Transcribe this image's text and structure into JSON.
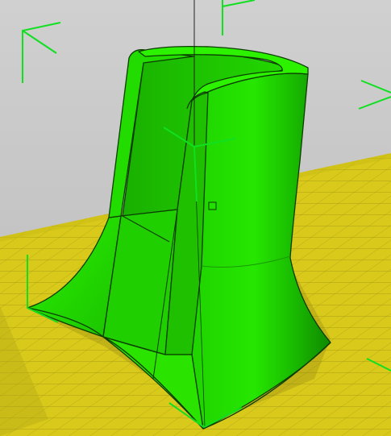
{
  "viewport": {
    "background_top": "#cfcfcf",
    "background_bottom": "#b9b9b9",
    "build_plate_color": "#d8c81a",
    "build_plate_line_color": "#9e9312",
    "model_color_light": "#22e000",
    "model_color_mid": "#1ab800",
    "model_color_dark": "#128f00",
    "outline_color": "#0d3d00",
    "gizmo_color": "#10e020"
  }
}
